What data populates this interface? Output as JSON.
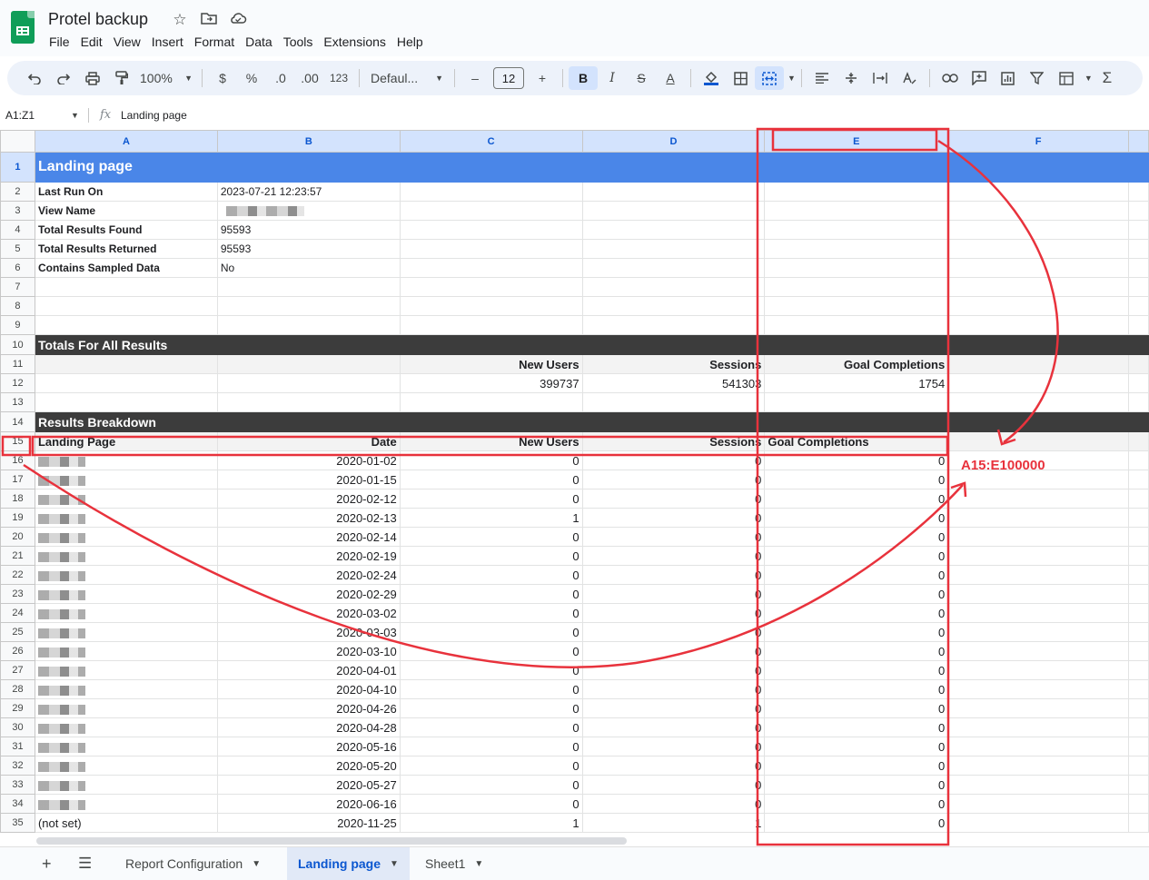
{
  "app": {
    "doc_title": "Protel backup"
  },
  "menu": [
    "File",
    "Edit",
    "View",
    "Insert",
    "Format",
    "Data",
    "Tools",
    "Extensions",
    "Help"
  ],
  "toolbar": {
    "zoom": "100%",
    "currency": "$",
    "percent": "%",
    "dec_decrease": ".0",
    "dec_increase": ".00",
    "number_format": "123",
    "font": "Defaul...",
    "font_size": "12",
    "bold": "B",
    "italic": "I",
    "text_color": "A"
  },
  "formula_bar": {
    "name_box": "A1:Z1",
    "fx": "fx",
    "content": "Landing page"
  },
  "columns": [
    "A",
    "B",
    "C",
    "D",
    "E",
    "F"
  ],
  "rows": [
    {
      "n": "1",
      "style": "title",
      "a": "Landing page"
    },
    {
      "n": "2",
      "a": "Last Run On",
      "b": "2023-07-21 12:23:57"
    },
    {
      "n": "3",
      "a": "View Name",
      "b": ""
    },
    {
      "n": "4",
      "a": "Total Results Found",
      "b": "95593"
    },
    {
      "n": "5",
      "a": "Total Results Returned",
      "b": "95593"
    },
    {
      "n": "6",
      "a": "Contains Sampled Data",
      "b": "No"
    },
    {
      "n": "7"
    },
    {
      "n": "8"
    },
    {
      "n": "9"
    },
    {
      "n": "10",
      "style": "dark",
      "a": "Totals For All Results"
    },
    {
      "n": "11",
      "style": "hdr",
      "c": "New Users",
      "d": "Sessions",
      "e": "Goal Completions"
    },
    {
      "n": "12",
      "c": "399737",
      "d": "541303",
      "e": "1754"
    },
    {
      "n": "13"
    },
    {
      "n": "14",
      "style": "dark",
      "a": "Results Breakdown"
    },
    {
      "n": "15",
      "style": "hdr",
      "a": "Landing Page",
      "b": "Date",
      "c": "New Users",
      "d": "Sessions",
      "e": "Goal Completions"
    },
    {
      "n": "16",
      "b": "2020-01-02",
      "c": "0",
      "d": "0",
      "e": "0"
    },
    {
      "n": "17",
      "b": "2020-01-15",
      "c": "0",
      "d": "0",
      "e": "0"
    },
    {
      "n": "18",
      "b": "2020-02-12",
      "c": "0",
      "d": "0",
      "e": "0"
    },
    {
      "n": "19",
      "b": "2020-02-13",
      "c": "1",
      "d": "0",
      "e": "0"
    },
    {
      "n": "20",
      "b": "2020-02-14",
      "c": "0",
      "d": "0",
      "e": "0"
    },
    {
      "n": "21",
      "b": "2020-02-19",
      "c": "0",
      "d": "0",
      "e": "0"
    },
    {
      "n": "22",
      "b": "2020-02-24",
      "c": "0",
      "d": "0",
      "e": "0"
    },
    {
      "n": "23",
      "b": "2020-02-29",
      "c": "0",
      "d": "0",
      "e": "0"
    },
    {
      "n": "24",
      "b": "2020-03-02",
      "c": "0",
      "d": "0",
      "e": "0"
    },
    {
      "n": "25",
      "b": "2020-03-03",
      "c": "0",
      "d": "0",
      "e": "0"
    },
    {
      "n": "26",
      "b": "2020-03-10",
      "c": "0",
      "d": "0",
      "e": "0"
    },
    {
      "n": "27",
      "b": "2020-04-01",
      "c": "0",
      "d": "0",
      "e": "0"
    },
    {
      "n": "28",
      "b": "2020-04-10",
      "c": "0",
      "d": "0",
      "e": "0"
    },
    {
      "n": "29",
      "b": "2020-04-26",
      "c": "0",
      "d": "0",
      "e": "0"
    },
    {
      "n": "30",
      "b": "2020-04-28",
      "c": "0",
      "d": "0",
      "e": "0"
    },
    {
      "n": "31",
      "b": "2020-05-16",
      "c": "0",
      "d": "0",
      "e": "0"
    },
    {
      "n": "32",
      "b": "2020-05-20",
      "c": "0",
      "d": "0",
      "e": "0"
    },
    {
      "n": "33",
      "b": "2020-05-27",
      "c": "0",
      "d": "0",
      "e": "0"
    },
    {
      "n": "34",
      "b": "2020-06-16",
      "c": "0",
      "d": "0",
      "e": "0"
    },
    {
      "n": "35",
      "a": "(not set)",
      "b": "2020-11-25",
      "c": "1",
      "d": "1",
      "e": "0"
    }
  ],
  "annotation": {
    "range_label": "A15:E100000",
    "color": "#e8323c"
  },
  "tabs": [
    {
      "label": "Report Configuration",
      "active": false
    },
    {
      "label": "Landing page",
      "active": true
    },
    {
      "label": "Sheet1",
      "active": false
    }
  ],
  "colors": {
    "title_fill": "#4a86e8",
    "section_fill": "#3c3c3c",
    "header_fill": "#f3f3f3",
    "accent": "#0b57d0"
  }
}
